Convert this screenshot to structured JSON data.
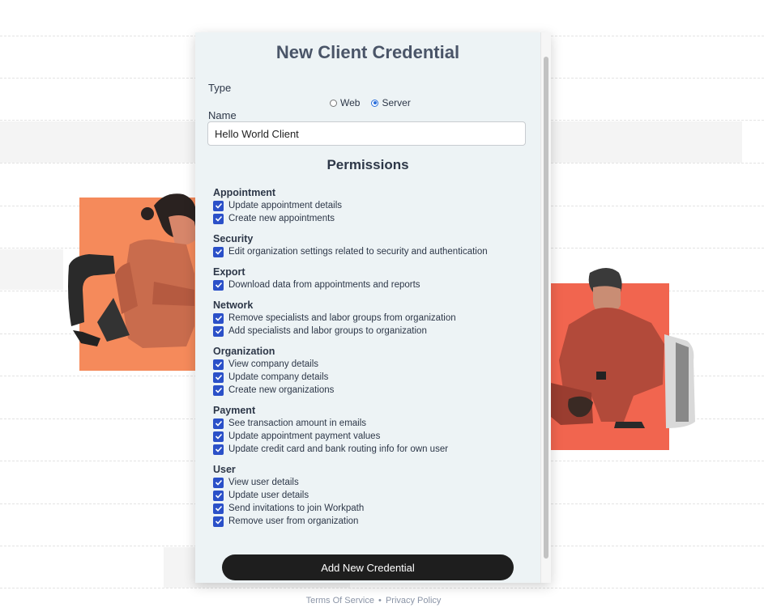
{
  "modal": {
    "title": "New Client Credential",
    "type_label": "Type",
    "type_options": [
      {
        "label": "Web",
        "selected": false
      },
      {
        "label": "Server",
        "selected": true
      }
    ],
    "name_label": "Name",
    "name_value": "Hello World Client",
    "permissions_title": "Permissions",
    "groups": [
      {
        "title": "Appointment",
        "items": [
          "Update appointment details",
          "Create new appointments"
        ]
      },
      {
        "title": "Security",
        "items": [
          "Edit organization settings related to security and authentication"
        ]
      },
      {
        "title": "Export",
        "items": [
          "Download data from appointments and reports"
        ]
      },
      {
        "title": "Network",
        "items": [
          "Remove specialists and labor groups from organization",
          "Add specialists and labor groups to organization"
        ]
      },
      {
        "title": "Organization",
        "items": [
          "View company details",
          "Update company details",
          "Create new organizations"
        ]
      },
      {
        "title": "Payment",
        "items": [
          "See transaction amount in emails",
          "Update appointment payment values",
          "Update credit card and bank routing info for own user"
        ]
      },
      {
        "title": "User",
        "items": [
          "View user details",
          "Update user details",
          "Send invitations to join Workpath",
          "Remove user from organization"
        ]
      }
    ],
    "submit_label": "Add New Credential"
  },
  "footer": {
    "terms": "Terms Of Service",
    "separator": "•",
    "privacy": "Privacy Policy"
  },
  "colors": {
    "accent_orange": "#f58a5b",
    "accent_coral": "#f1654f",
    "checkbox_blue": "#2b50c8",
    "button_dark": "#1e1e1e"
  }
}
